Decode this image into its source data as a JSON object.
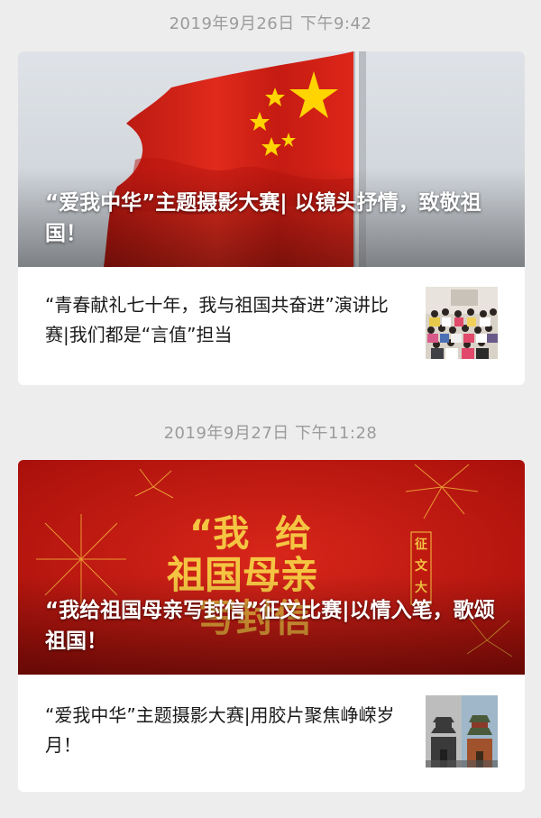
{
  "feed": [
    {
      "timestamp": "2019年9月26日 下午9:42",
      "cover": {
        "title": "“爱我中华”主题摄影大赛| 以镜头抒情，致敬祖国！",
        "image": "flag-icon"
      },
      "sub_article": {
        "title": "“青春献礼七十年，我与祖国共奋进”演讲比赛|我们都是“言值”担当",
        "thumb": "group-photo"
      }
    },
    {
      "timestamp": "2019年9月27日 下午11:28",
      "cover": {
        "title": "“我给祖国母亲写封信”征文比赛|以情入笔，歌颂祖国！",
        "image": "fireworks-banner",
        "banner_lines": [
          "“我 给",
          "祖国母亲",
          "写封信"
        ],
        "banner_side": [
          "征",
          "文",
          "大"
        ]
      },
      "sub_article": {
        "title": "“爱我中华”主题摄影大赛|用胶片聚焦峥嵘岁月！",
        "thumb": "bell-tower-photo"
      }
    }
  ],
  "colors": {
    "background": "#ededed",
    "card": "#ffffff",
    "timestamp": "#9b9b9b",
    "flag_red": "#d8221a",
    "banner_red": "#c0170f",
    "banner_gold": "#f5c542"
  }
}
